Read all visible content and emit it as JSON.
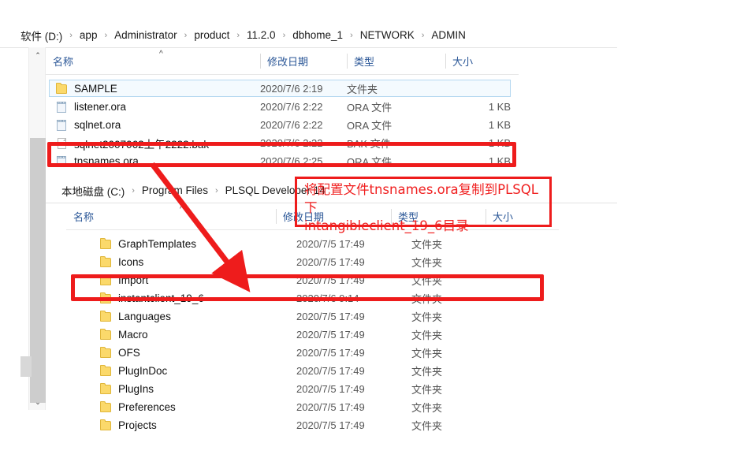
{
  "window_top": {
    "breadcrumb": {
      "name": "address-bar",
      "parts": [
        "软件 (D:)",
        "app",
        "Administrator",
        "product",
        "11.2.0",
        "dbhome_1",
        "NETWORK",
        "ADMIN"
      ],
      "separator": "›"
    },
    "columns": [
      {
        "key": "name",
        "label": "名称"
      },
      {
        "key": "date",
        "label": "修改日期"
      },
      {
        "key": "type",
        "label": "类型"
      },
      {
        "key": "size",
        "label": "大小"
      }
    ],
    "sort_indicator": "^",
    "rows": [
      {
        "name": "SAMPLE",
        "date": "2020/7/6 2:19",
        "type": "文件夹",
        "size": "",
        "icon": "folder-icon",
        "selected": true
      },
      {
        "name": "listener.ora",
        "date": "2020/7/6 2:22",
        "type": "ORA 文件",
        "size": "1 KB",
        "icon": "notepad-file-icon",
        "selected": false
      },
      {
        "name": "sqlnet.ora",
        "date": "2020/7/6 2:22",
        "type": "ORA 文件",
        "size": "1 KB",
        "icon": "notepad-file-icon",
        "selected": false
      },
      {
        "name": "sqlnet2007062上午2222.bak",
        "date": "2020/7/6 2:22",
        "type": "BAK 文件",
        "size": "1 KB",
        "icon": "blank-document-icon",
        "selected": false
      },
      {
        "name": "tnsnames.ora",
        "date": "2020/7/6 2:25",
        "type": "ORA 文件",
        "size": "1 KB",
        "icon": "notepad-file-icon",
        "selected": false
      }
    ]
  },
  "window_bottom": {
    "breadcrumb": {
      "name": "address-bar",
      "parts": [
        "本地磁盘 (C:)",
        "Program Files",
        "PLSQL Developer 14"
      ],
      "separator": "›"
    },
    "columns": [
      {
        "key": "name",
        "label": "名称"
      },
      {
        "key": "date",
        "label": "修改日期"
      },
      {
        "key": "type",
        "label": "类型"
      },
      {
        "key": "size",
        "label": "大小"
      }
    ],
    "sort_indicator": "^",
    "rows": [
      {
        "name": "GraphTemplates",
        "date": "2020/7/5 17:49",
        "type": "文件夹",
        "size": "",
        "icon": "folder-icon"
      },
      {
        "name": "Icons",
        "date": "2020/7/5 17:49",
        "type": "文件夹",
        "size": "",
        "icon": "folder-icon"
      },
      {
        "name": "Import",
        "date": "2020/7/5 17:49",
        "type": "文件夹",
        "size": "",
        "icon": "folder-icon"
      },
      {
        "name": "instantclient_19_6",
        "date": "2020/7/6 9:14",
        "type": "文件夹",
        "size": "",
        "icon": "folder-icon"
      },
      {
        "name": "Languages",
        "date": "2020/7/5 17:49",
        "type": "文件夹",
        "size": "",
        "icon": "folder-icon"
      },
      {
        "name": "Macro",
        "date": "2020/7/5 17:49",
        "type": "文件夹",
        "size": "",
        "icon": "folder-icon"
      },
      {
        "name": "OFS",
        "date": "2020/7/5 17:49",
        "type": "文件夹",
        "size": "",
        "icon": "folder-icon"
      },
      {
        "name": "PlugInDoc",
        "date": "2020/7/5 17:49",
        "type": "文件夹",
        "size": "",
        "icon": "folder-icon"
      },
      {
        "name": "PlugIns",
        "date": "2020/7/5 17:49",
        "type": "文件夹",
        "size": "",
        "icon": "folder-icon"
      },
      {
        "name": "Preferences",
        "date": "2020/7/5 17:49",
        "type": "文件夹",
        "size": "",
        "icon": "folder-icon"
      },
      {
        "name": "Projects",
        "date": "2020/7/5 17:49",
        "type": "文件夹",
        "size": "",
        "icon": "folder-icon"
      }
    ]
  },
  "scrollbar": {
    "up_arrow": "⌃",
    "down_arrow": "⌄"
  },
  "annotation": {
    "text": "将配置文件tnsnames.ora复制到PLSQL下\nintangibleclient_19_6目录",
    "color": "#f02020",
    "highlight_source": "tnsnames.ora",
    "highlight_target": "instantclient_19_6"
  }
}
